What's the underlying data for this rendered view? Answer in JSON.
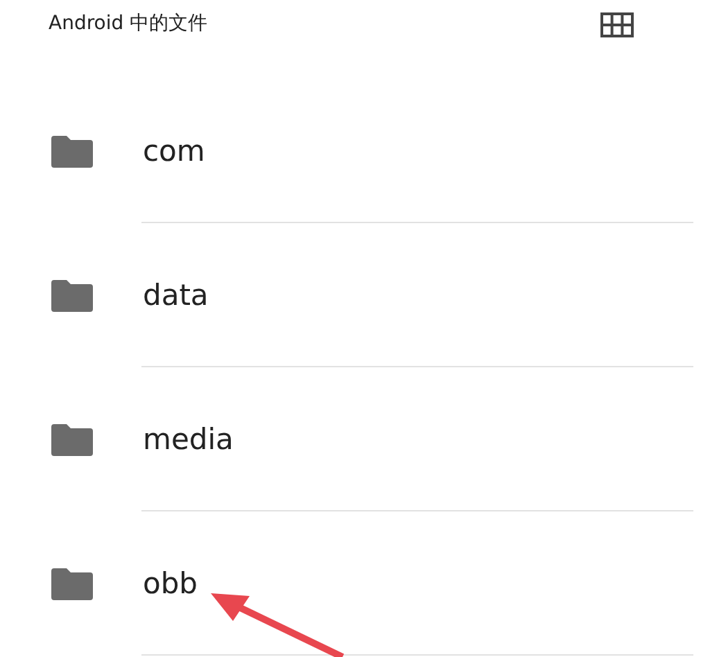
{
  "header": {
    "title": "Android 中的文件"
  },
  "folders": [
    {
      "name": "com"
    },
    {
      "name": "data"
    },
    {
      "name": "media"
    },
    {
      "name": "obb"
    }
  ]
}
